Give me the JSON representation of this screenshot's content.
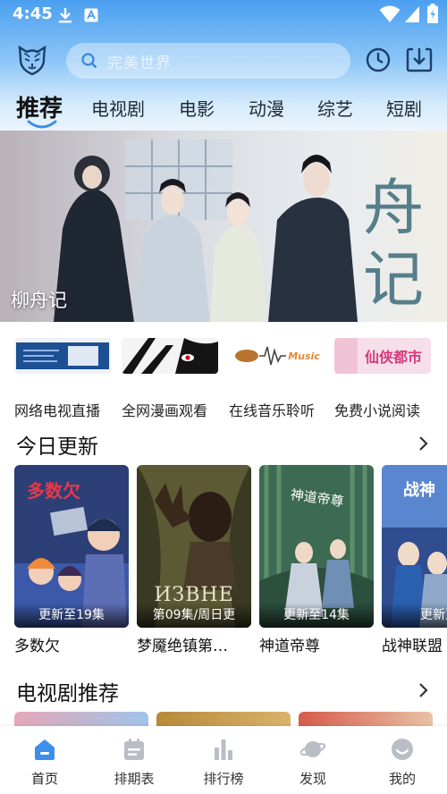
{
  "status_bar": {
    "time": "4:45"
  },
  "header": {
    "search_placeholder": "完美世界"
  },
  "tabs": [
    {
      "label": "推荐",
      "active": true
    },
    {
      "label": "电视剧"
    },
    {
      "label": "电影"
    },
    {
      "label": "动漫"
    },
    {
      "label": "综艺"
    },
    {
      "label": "短剧"
    }
  ],
  "banner": {
    "title": "柳舟记",
    "calligraphy": "舟记"
  },
  "shortcuts": [
    {
      "label": "网络电视直播"
    },
    {
      "label": "全网漫画观看"
    },
    {
      "label": "在线音乐聆听",
      "image_text": "Music"
    },
    {
      "label": "免费小说阅读",
      "image_text": "仙侠都市"
    }
  ],
  "today_updates": {
    "title": "今日更新",
    "items": [
      {
        "title": "多数欠",
        "badge": "更新至19集",
        "poster_text": "多数欠"
      },
      {
        "title": "梦魇绝镇第…",
        "badge": "第09集/周日更",
        "poster_text": "ИЗВНЕ"
      },
      {
        "title": "神道帝尊",
        "badge": "更新至14集",
        "poster_text": "神道帝尊"
      },
      {
        "title": "战神联盟",
        "badge": "更新至",
        "poster_text": "战神"
      }
    ]
  },
  "tv_recommend": {
    "title": "电视剧推荐"
  },
  "bottom_nav": [
    {
      "label": "首页",
      "icon": "home-icon",
      "active": true
    },
    {
      "label": "排期表",
      "icon": "calendar-icon"
    },
    {
      "label": "排行榜",
      "icon": "bar-chart-icon"
    },
    {
      "label": "发现",
      "icon": "planet-icon"
    },
    {
      "label": "我的",
      "icon": "profile-icon"
    }
  ],
  "colors": {
    "accent": "#4a9ff0",
    "nav_active": "#3b8fe8",
    "nav_inactive": "#b9bec6"
  }
}
